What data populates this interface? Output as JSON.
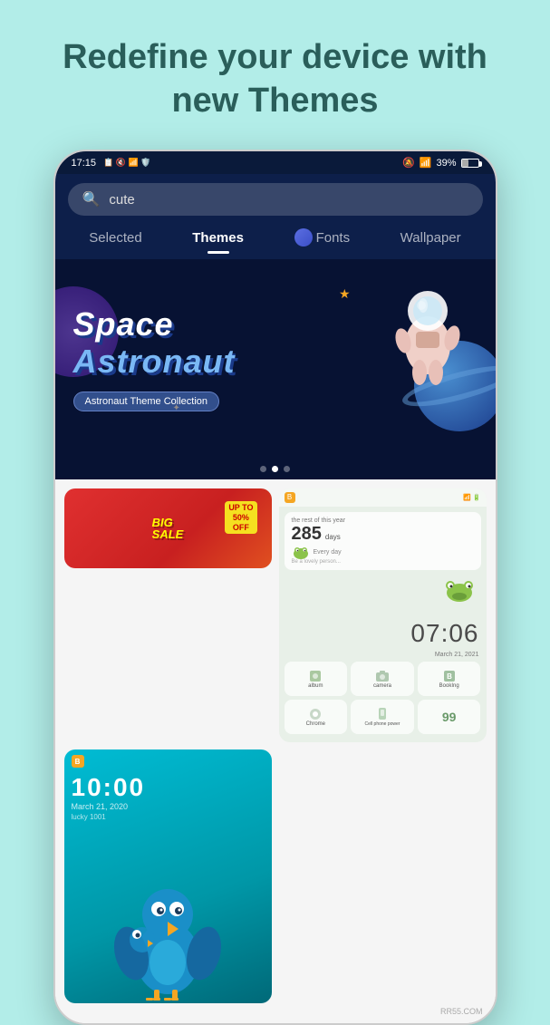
{
  "headline": {
    "line1": "Redefine your device with",
    "line2": "new Themes"
  },
  "status_bar": {
    "time": "17:15",
    "battery": "39%",
    "signal_icons": "🔔 ✦ 39%"
  },
  "search": {
    "placeholder": "cute",
    "icon": "🔍"
  },
  "tabs": [
    {
      "label": "Selected",
      "active": false
    },
    {
      "label": "Themes",
      "active": true
    },
    {
      "label": "Fonts",
      "active": false,
      "has_dot": true
    },
    {
      "label": "Wallpaper",
      "active": false
    }
  ],
  "banner": {
    "title_line1": "Space",
    "title_line2": "Astronaut",
    "badge": "Astronaut Theme Collection"
  },
  "carousel_dots": [
    {
      "active": false
    },
    {
      "active": true
    },
    {
      "active": false
    }
  ],
  "cards": {
    "big_sale": {
      "main_text": "BIG",
      "sub_text": "SALE",
      "upto": "UP TO",
      "percent": "50%",
      "off": "OFF"
    },
    "green_theme": {
      "counter_label": "the rest of this year",
      "days": "285",
      "days_unit": "days",
      "every_day": "Every day",
      "be_lovely": "Be a lovely person...",
      "time": "07:06",
      "date": "March 21, 2021",
      "apps": [
        {
          "label": "album"
        },
        {
          "label": "camera"
        },
        {
          "label": "BookIng"
        },
        {
          "label": "Chrome"
        },
        {
          "label": "Cell phone power"
        },
        {
          "label": ""
        }
      ],
      "bottom_number": "99"
    },
    "blue_bird": {
      "time": "10:00",
      "date": "March 21, 2020",
      "slogan": "lucky 1001"
    }
  },
  "watermark": {
    "text": "RR55.COM"
  },
  "colors": {
    "bg": "#b2ede8",
    "headline": "#2a5e5a",
    "phone_dark": "#0d1f4a",
    "banner_bg": "#071233"
  }
}
